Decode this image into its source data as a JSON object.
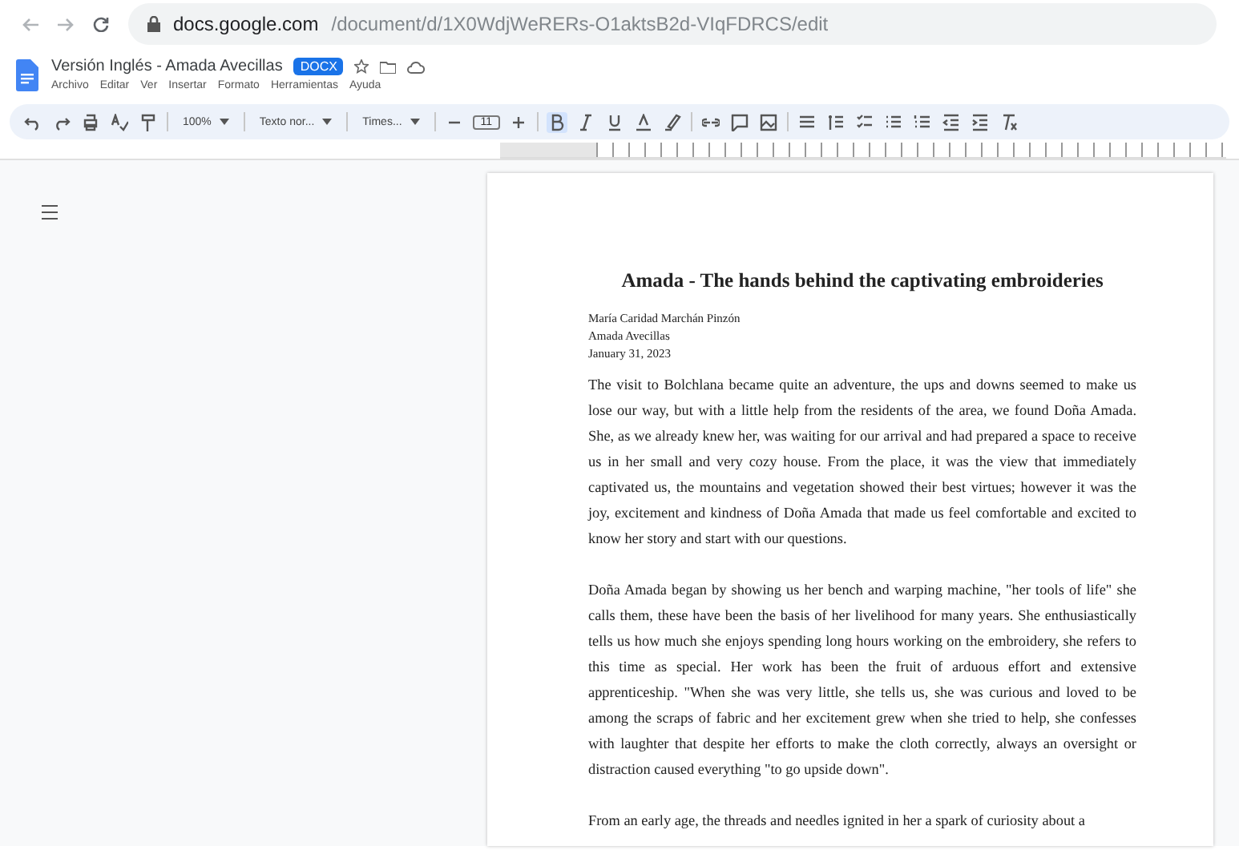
{
  "browser": {
    "url_domain": "docs.google.com",
    "url_path": "/document/d/1X0WdjWeRERs-O1aktsB2d-VIqFDRCS/edit"
  },
  "document_header": {
    "title": "Versión Inglés - Amada Avecillas",
    "badge": "DOCX"
  },
  "menu": [
    "Archivo",
    "Editar",
    "Ver",
    "Insertar",
    "Formato",
    "Herramientas",
    "Ayuda"
  ],
  "toolbar": {
    "zoom": "100%",
    "style": "Texto nor...",
    "font": "Times...",
    "font_size": "11",
    "bold_selected": true
  },
  "page": {
    "title": "Amada - The hands behind the captivating embroideries",
    "byline": [
      "María Caridad Marchán Pinzón",
      "Amada Avecillas",
      "January 31, 2023"
    ],
    "paragraphs": [
      "The visit to Bolchlana became quite an adventure, the ups and downs seemed to make us lose our way, but with a little help from the residents of the area, we found Doña Amada. She, as we already knew her, was waiting for our arrival and had prepared a space to receive us in her small and very cozy house. From the place, it was the view that immediately captivated us, the mountains and vegetation showed their best virtues; however it was the joy, excitement and kindness of Doña Amada that made us feel comfortable and excited to know her story and start with our questions.",
      "Doña Amada began by showing us her bench and warping machine, \"her tools of life\" she calls them, these have been the basis of her livelihood for many years. She enthusiastically tells us how much she enjoys spending long hours working on the embroidery, she refers to this time as special. Her work has been the fruit of arduous effort and extensive apprenticeship. \"When she was very little, she tells us, she was curious and loved to be among the scraps of fabric and her excitement grew when she tried to help, she confesses with laughter that despite her efforts to make the cloth correctly, always an oversight or distraction caused everything \"to go upside down\".",
      "From an early age, the threads and needles ignited in her a spark of curiosity about a"
    ]
  }
}
